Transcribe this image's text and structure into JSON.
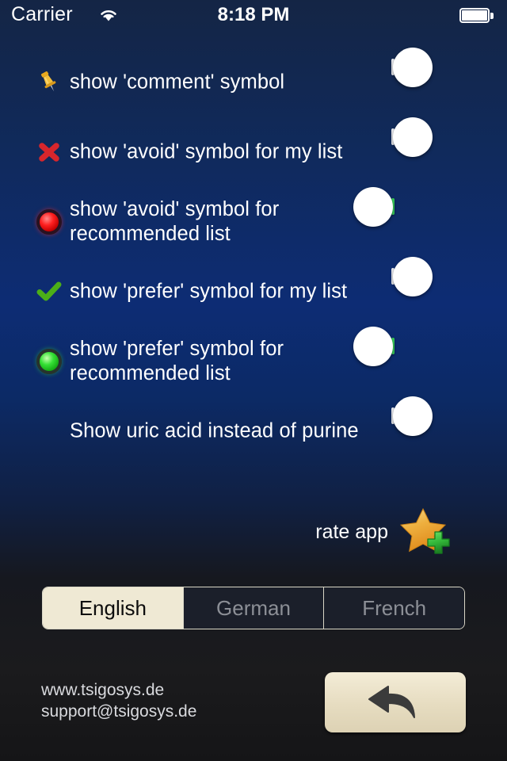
{
  "status_bar": {
    "carrier": "Carrier",
    "wifi_icon": "wifi-icon",
    "time": "8:18 PM",
    "battery_icon": "battery-icon"
  },
  "settings": {
    "rows": [
      {
        "icon": "pushpin-icon",
        "label": "show 'comment' symbol",
        "toggle_state": "off"
      },
      {
        "icon": "red-x-icon",
        "label": "show 'avoid' symbol for my list",
        "toggle_state": "off"
      },
      {
        "icon": "red-led-icon",
        "label": "show 'avoid' symbol for recommended list",
        "toggle_state": "on"
      },
      {
        "icon": "green-check-icon",
        "label": "show 'prefer' symbol for my list",
        "toggle_state": "off"
      },
      {
        "icon": "green-led-icon",
        "label": "show 'prefer' symbol for recommended list",
        "toggle_state": "on"
      },
      {
        "icon": "none",
        "label": "Show uric acid instead of purine",
        "toggle_state": "off"
      }
    ]
  },
  "rate_app": {
    "label": "rate app",
    "icon": "star-plus-icon"
  },
  "language": {
    "options": [
      {
        "label": "English",
        "selected": true
      },
      {
        "label": "German",
        "selected": false
      },
      {
        "label": "French",
        "selected": false
      }
    ]
  },
  "footer": {
    "website": "www.tsigosys.de",
    "email": "support@tsigosys.de",
    "back_icon": "back-arrow-icon"
  },
  "colors": {
    "toggle_on": "#3ed35f",
    "segment_selected_bg": "#efe9d4",
    "back_button_bg": "#e6dcc0",
    "text": "#ffffff",
    "background_top": "#142545",
    "background_mid": "#0d2c74",
    "background_bottom": "#1b1b1d"
  }
}
